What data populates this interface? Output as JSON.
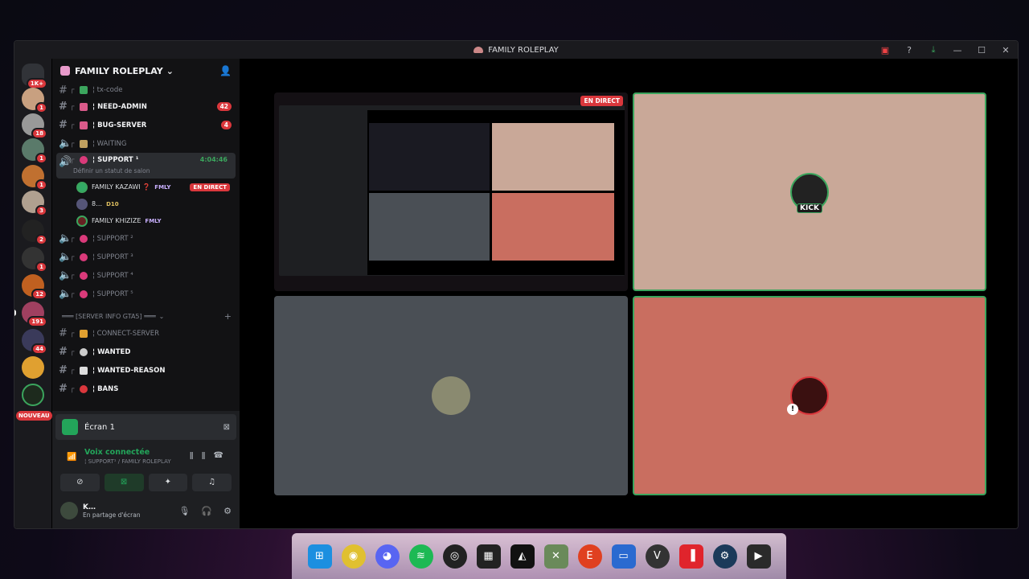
{
  "window": {
    "title": "FAMILY ROLEPLAY"
  },
  "guilds": {
    "badges": [
      "1K+",
      "1",
      "18",
      "1",
      "1",
      "3",
      "2",
      "1",
      "12",
      "191",
      "44"
    ],
    "new_label": "NOUVEAU"
  },
  "server": {
    "name": "FAMILY ROLEPLAY"
  },
  "channels": [
    {
      "label": "¦ tx-code"
    },
    {
      "label": "¦ NEED-ADMIN",
      "count": "42"
    },
    {
      "label": "¦ BUG-SERVER",
      "count": "4"
    },
    {
      "label": "¦ WAITING"
    },
    {
      "label": "¦ SUPPORT ¹",
      "time": "4:04:46",
      "status": "Définir un statut de salon"
    },
    {
      "label": "¦ SUPPORT ²"
    },
    {
      "label": "¦ SUPPORT ³"
    },
    {
      "label": "¦ SUPPORT ⁴"
    },
    {
      "label": "¦ SUPPORT ⁵"
    },
    {
      "label": "¦ CONNECT-SERVER"
    },
    {
      "label": "¦ WANTED"
    },
    {
      "label": "¦ WANTED-REASON"
    },
    {
      "label": "¦ BANS"
    }
  ],
  "voice_users": [
    {
      "name": "FAMILY KAZAWI ❓",
      "tag": "FMLY",
      "live": "EN DIRECT"
    },
    {
      "name": "8…",
      "tag": "D10"
    },
    {
      "name": "FAMILY KHIZIZE",
      "tag": "FMLY"
    }
  ],
  "category": {
    "label": "═══ [SERVER INFO GTA5] ═══"
  },
  "panel": {
    "screen_title": "Écran 1",
    "voice_status": "Voix connectée",
    "voice_sub": "¦ SUPPORT¹ / FAMILY ROLEPLAY",
    "user_name": "K…",
    "user_status": "En partage d'écran"
  },
  "stage": {
    "live_badge": "EN DIRECT",
    "kick_label": "KICK"
  },
  "colors": {
    "tile_beige": "#c9a898",
    "tile_slate": "#4a4f55",
    "tile_salmon": "#c96e60",
    "accent_green": "#3ba55d",
    "badge_red": "#da373c"
  },
  "taskbar": {
    "apps": [
      "windows-icon",
      "chrome-icon",
      "discord-icon",
      "spotify-icon",
      "obs-icon",
      "msi-icon",
      "arc-raiders-icon",
      "xbox-icon",
      "ea-icon",
      "pc-icon",
      "gta-icon",
      "faceit-icon",
      "steam-icon",
      "game-icon"
    ]
  }
}
